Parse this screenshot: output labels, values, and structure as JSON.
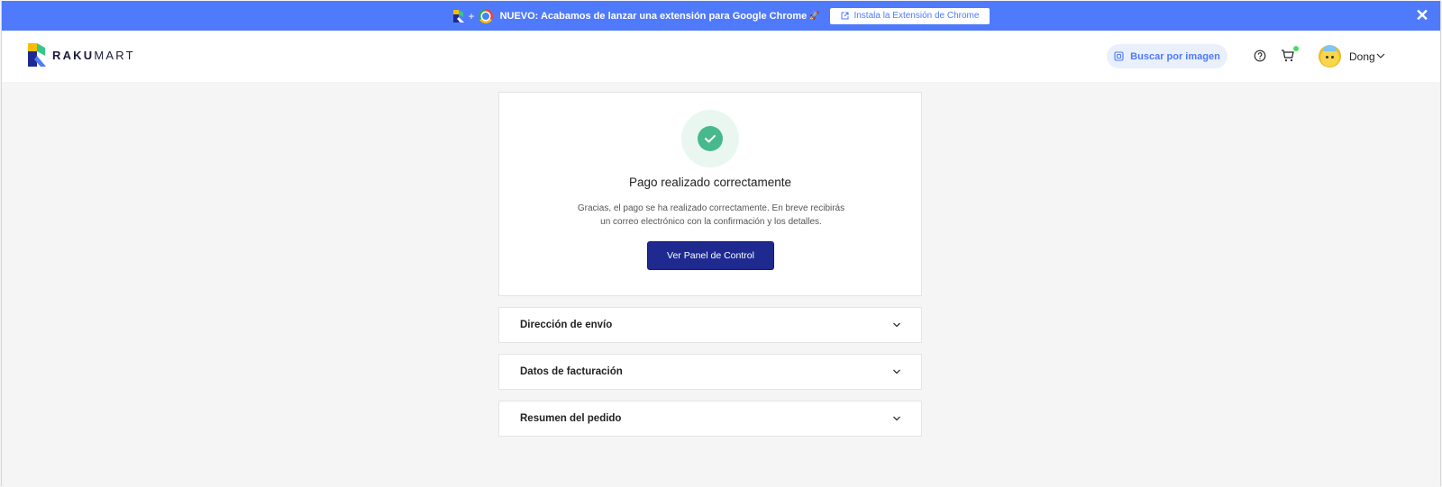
{
  "announcement": {
    "plus": "+",
    "text": "NUEVO: Acabamos de lanzar una extensión para Google Chrome",
    "button_label": "Instala la Extensión de Chrome",
    "close_icon": "close-icon"
  },
  "header": {
    "brand": {
      "bold": "RAKU",
      "light": "MART"
    },
    "search_by_image": "Buscar por imagen",
    "username": "Dong"
  },
  "success": {
    "title": "Pago realizado correctamente",
    "description_line1": "Gracias, el pago se ha realizado correctamente. En breve recibirás",
    "description_line2": "un correo electrónico con la confirmación y los detalles.",
    "button_label": "Ver Panel de Control"
  },
  "sections": [
    {
      "title": "Dirección de envío"
    },
    {
      "title": "Datos de facturación"
    },
    {
      "title": "Resumen del pedido"
    }
  ],
  "colors": {
    "announcement_bg": "#4f7afc",
    "primary_button": "#1e2a8f",
    "success_green": "#48b98c",
    "cart_badge": "#4cd964"
  }
}
